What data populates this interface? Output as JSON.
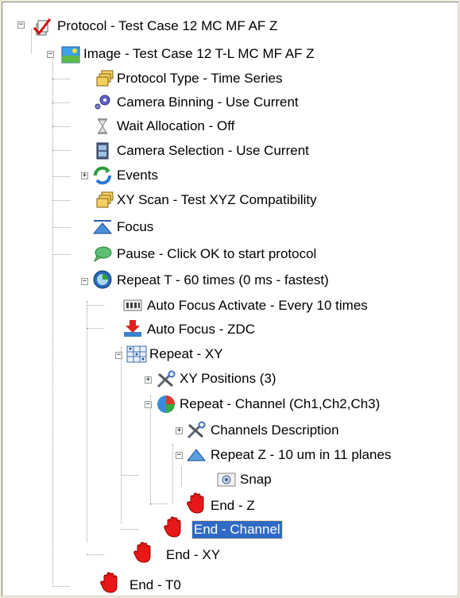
{
  "tree": {
    "nodes": [
      {
        "label": "Protocol - Test Case 12 MC MF AF Z",
        "icon": "protocol-checkmark-icon",
        "toggle": "−"
      },
      {
        "label": "Image - Test Case 12 T-L MC MF AF Z",
        "icon": "image-landscape-icon",
        "toggle": "−"
      },
      {
        "label": "Protocol Type - Time Series",
        "icon": "stacked-folders-icon"
      },
      {
        "label": "Camera Binning - Use Current",
        "icon": "camera-binning-gear-icon"
      },
      {
        "label": "Wait Allocation - Off",
        "icon": "hourglass-icon"
      },
      {
        "label": "Camera Selection - Use Current",
        "icon": "film-camera-icon"
      },
      {
        "label": "Events",
        "icon": "events-refresh-icon",
        "toggle": "+"
      },
      {
        "label": "XY Scan - Test XYZ Compatibility",
        "icon": "stacked-folders-icon"
      },
      {
        "label": "Focus",
        "icon": "focus-triangle-icon"
      },
      {
        "label": "Pause - Click OK to start protocol",
        "icon": "speech-bubble-icon"
      },
      {
        "label": "Repeat T - 60 times (0 ms - fastest)",
        "icon": "clock-icon",
        "toggle": "−"
      },
      {
        "label": "Auto Focus Activate - Every 10 times",
        "icon": "counter-icon"
      },
      {
        "label": "Auto Focus - ZDC",
        "icon": "autofocus-arrow-icon"
      },
      {
        "label": "Repeat - XY",
        "icon": "xy-grid-icon",
        "toggle": "−"
      },
      {
        "label": "XY Positions (3)",
        "icon": "tools-icon",
        "toggle": "+"
      },
      {
        "label": "Repeat - Channel (Ch1,Ch2,Ch3)",
        "icon": "channel-pie-icon",
        "toggle": "−"
      },
      {
        "label": "Channels Description",
        "icon": "tools-icon",
        "toggle": "+"
      },
      {
        "label": "Repeat Z - 10 um in 11 planes",
        "icon": "z-triangle-icon",
        "toggle": "−"
      },
      {
        "label": "Snap",
        "icon": "snap-camera-icon"
      },
      {
        "label": "End - Z",
        "icon": "stop-hand-icon"
      },
      {
        "label": "End - Channel",
        "icon": "stop-hand-icon",
        "selected": true
      },
      {
        "label": "End - XY",
        "icon": "stop-hand-icon"
      },
      {
        "label": "End - T0",
        "icon": "stop-hand-icon"
      }
    ]
  },
  "colors": {
    "selection_bg": "#316ac5",
    "stop_hand": "#e81818",
    "tree_line": "#a0a0a0"
  }
}
